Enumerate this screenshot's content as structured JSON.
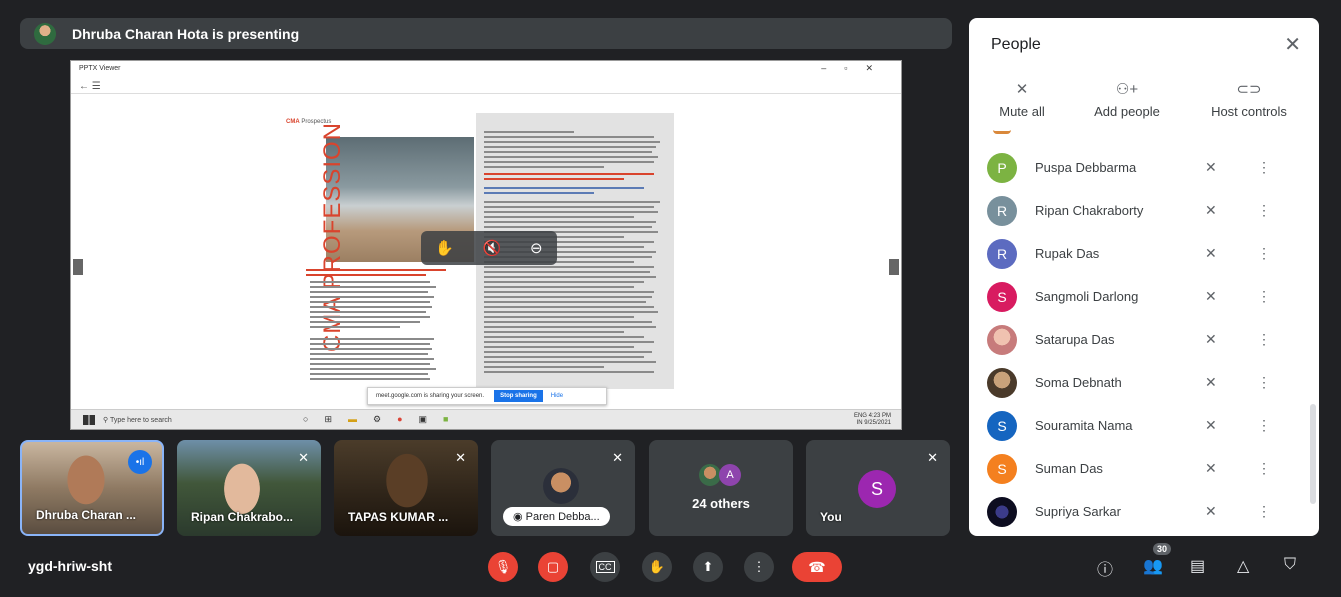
{
  "presenting": {
    "text": "Dhruba Charan Hota is presenting"
  },
  "shared_screen": {
    "viewer_title": "PPTX Viewer",
    "prospectus_prefix": "CMA",
    "prospectus_label": "Prospectus",
    "cma_title": "CMA PROFESSION",
    "taskbar_search": "Type here to search",
    "tray_lang": "ENG",
    "tray_region": "IN",
    "tray_time": "4:23 PM",
    "tray_date": "9/25/2021",
    "share_banner_text": "meet.google.com is sharing your screen.",
    "stop_sharing_label": "Stop sharing",
    "hide_label": "Hide"
  },
  "tiles": [
    {
      "name": "Dhruba Charan ...",
      "active": true
    },
    {
      "name": "Ripan Chakrabo..."
    },
    {
      "name": "TAPAS KUMAR ..."
    },
    {
      "name": "Paren Debba..."
    },
    {
      "name": "24 others",
      "avatar_letter": "A"
    },
    {
      "name": "You",
      "avatar_letter": "S"
    }
  ],
  "meeting": {
    "code": "ygd-hriw-sht",
    "people_count": "30"
  },
  "panel": {
    "title": "People",
    "actions": [
      {
        "label": "Mute all",
        "icon": "mic-off-icon"
      },
      {
        "label": "Add people",
        "icon": "add-person-icon"
      },
      {
        "label": "Host controls",
        "icon": "toggle-icon"
      }
    ],
    "participants": [
      {
        "name": "Puspa Debbarma",
        "initial": "P",
        "color": "#7cb342",
        "photo": false
      },
      {
        "name": "Ripan Chakraborty",
        "initial": "R",
        "color": "#78909c",
        "photo": false
      },
      {
        "name": "Rupak Das",
        "initial": "R",
        "color": "#5c6bc0",
        "photo": false
      },
      {
        "name": "Sangmoli Darlong",
        "initial": "S",
        "color": "#d81b60",
        "photo": false
      },
      {
        "name": "Satarupa Das",
        "initial": "",
        "color": "#e0a0a0",
        "photo": true
      },
      {
        "name": "Soma Debnath",
        "initial": "",
        "color": "#8a6d4d",
        "photo": true
      },
      {
        "name": "Souramita Nama",
        "initial": "S",
        "color": "#1565c0",
        "photo": false
      },
      {
        "name": "Suman Das",
        "initial": "S",
        "color": "#f4801f",
        "photo": false
      },
      {
        "name": "Supriya Sarkar",
        "initial": "",
        "color": "#1a1a3a",
        "photo": true
      }
    ]
  }
}
